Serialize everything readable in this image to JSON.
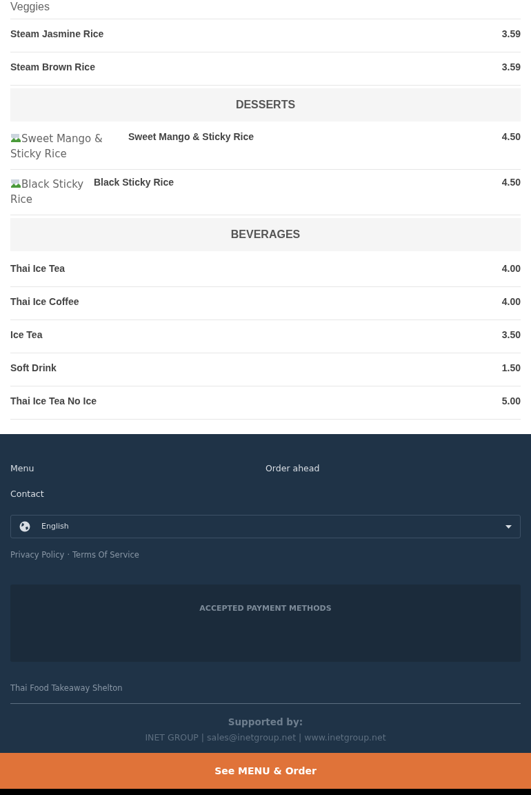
{
  "top_fragment": "Veggies",
  "menu": [
    {
      "kind": "item",
      "name": "Steam Jasmine Rice",
      "price": "3.59"
    },
    {
      "kind": "item",
      "name": "Steam Brown Rice",
      "price": "3.59"
    },
    {
      "kind": "heading",
      "title": "DESSERTS"
    },
    {
      "kind": "image_item",
      "image_alt": "Sweet Mango & Sticky Rice",
      "name": "Sweet Mango & Sticky Rice",
      "price": "4.50"
    },
    {
      "kind": "image_item",
      "image_alt": "Black Sticky Rice",
      "name": "Black Sticky Rice",
      "price": "4.50"
    },
    {
      "kind": "heading",
      "title": "BEVERAGES"
    },
    {
      "kind": "item",
      "name": "Thai Ice Tea",
      "price": "4.00"
    },
    {
      "kind": "item",
      "name": "Thai Ice Coffee",
      "price": "4.00"
    },
    {
      "kind": "item",
      "name": "Ice Tea",
      "price": "3.50"
    },
    {
      "kind": "item",
      "name": "Soft Drink",
      "price": "1.50"
    },
    {
      "kind": "item",
      "name": "Thai Ice Tea No Ice",
      "price": "5.00"
    }
  ],
  "footer": {
    "links": [
      "Menu",
      "Order ahead",
      "Contact"
    ],
    "language": "English",
    "legal_links": [
      "Privacy Policy",
      "Terms Of Service"
    ],
    "legal_separator": "·",
    "payment_title": "ACCEPTED PAYMENT METHODS",
    "restaurant": "Thai Food Takeaway Shelton",
    "supported_by": "Supported by:",
    "supporter_line": "INET GROUP | sales@inetgroup.net | www.inetgroup.net"
  },
  "order_button": "See MENU & Order"
}
